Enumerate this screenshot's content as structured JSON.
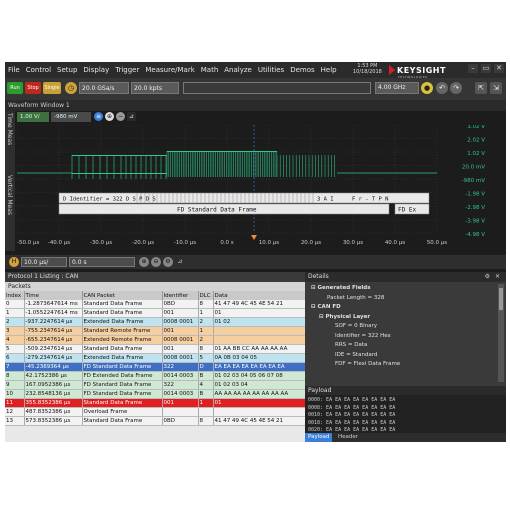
{
  "menu": [
    "File",
    "Control",
    "Setup",
    "Display",
    "Trigger",
    "Measure/Mark",
    "Math",
    "Analyze",
    "Utilities",
    "Demos",
    "Help"
  ],
  "datetime": {
    "time": "1:53 PM",
    "date": "10/18/2018"
  },
  "brand": {
    "name": "KEYSIGHT",
    "sub": "TECHNOLOGIES"
  },
  "toolbar": {
    "run": "Run",
    "stop": "Stop",
    "single": "Single",
    "sample_rate": "20.0 GSa/s",
    "memory_depth": "20.0 kpts",
    "bandwidth": "4.00 GHz"
  },
  "waveform": {
    "title": "Waveform Window 1",
    "side_tabs": [
      "Time Meas",
      "Vertical Meas"
    ],
    "channel_scale": "1.00 V/",
    "channel_offset": "-980 mV",
    "voltage_labels": [
      "3.02 V",
      "2.02 V",
      "1.02 V",
      "20.0 mV",
      "-980 mV",
      "-1.98 V",
      "-2.98 V",
      "-3.98 V",
      "-4.98 V"
    ],
    "time_labels": [
      "-50.0 µs",
      "-40.0 µs",
      "-30.0 µs",
      "-20.0 µs",
      "-10.0 µs",
      "0.0 s",
      "10.0 µs",
      "20.0 µs",
      "30.0 µs",
      "40.0 µs",
      "50.0 µs"
    ],
    "decode_line1": "D Identifier = 322  D S P D S",
    "decode_line1b": "3 A I",
    "decode_line1c": "F r - T P  N",
    "decode_line2": "FD Standard Data Frame",
    "decode_line2b": "FD Ex"
  },
  "timebase": {
    "scale": "10.0 µs/",
    "position": "0.0 s"
  },
  "listing": {
    "title": "Protocol 1 Listing : CAN",
    "section": "Packets",
    "columns": [
      "Index",
      "Time",
      "CAN Packet",
      "Identifier",
      "DLC",
      "Data"
    ],
    "rows": [
      [
        "0",
        "-1.2873647614 ms",
        "Standard Data Frame",
        "0BD",
        "8",
        "41 47 49 4C 45 4E 54 21"
      ],
      [
        "1",
        "-1.0552247614 ms",
        "Standard Data Frame",
        "001",
        "1",
        "01"
      ],
      [
        "2",
        "-937.2247614 µs",
        "Extended Data Frame",
        "0008 0001",
        "2",
        "01 02"
      ],
      [
        "3",
        "-755.2347614 µs",
        "Standard Remote Frame",
        "001",
        "1",
        ""
      ],
      [
        "4",
        "-655.2347614 µs",
        "Extended Remote Frame",
        "0008 0001",
        "2",
        ""
      ],
      [
        "5",
        "-509.2347614 µs",
        "Standard Data Frame",
        "001",
        "8",
        "01 AA BB CC AA AA AA AA"
      ],
      [
        "6",
        "-279.2347614 µs",
        "Extended Data Frame",
        "0008 0001",
        "5",
        "0A 0B 03 04 05"
      ],
      [
        "7",
        "-45.2369364 µs",
        "FD Standard Data Frame",
        "322",
        "D",
        "EA EA EA EA EA EA EA EA"
      ],
      [
        "8",
        "42.1752386 µs",
        "FD Extended Data Frame",
        "0014 0003",
        "B",
        "01 02 03 04 05 06 07 08"
      ],
      [
        "9",
        "167.0952386 µs",
        "FD Standard Data Frame",
        "322",
        "4",
        "01 02 03 04"
      ],
      [
        "10",
        "232.8548136 µs",
        "FD Standard Data Frame",
        "0014 0003",
        "B",
        "AA AA AA AA AA AA AA AA"
      ],
      [
        "11",
        "355.8352386 µs",
        "Standard Data Frame",
        "001",
        "1",
        "01"
      ],
      [
        "12",
        "487.8352386 µs",
        "Overload Frame",
        "",
        "",
        ""
      ],
      [
        "13",
        "573.8352386 µs",
        "Standard Data Frame",
        "0BD",
        "8",
        "41 47 49 4C 45 4E 54 21"
      ]
    ]
  },
  "details": {
    "title": "Details",
    "lines": [
      {
        "t": "Generated Fields",
        "lvl": 0,
        "bold": true
      },
      {
        "t": "Packet Length = 328",
        "lvl": 2,
        "bold": false
      },
      {
        "t": "CAN FD",
        "lvl": 0,
        "bold": true
      },
      {
        "t": "Physical Layer",
        "lvl": 1,
        "bold": true
      },
      {
        "t": "SOF = 0 Binary",
        "lvl": 3,
        "bold": false
      },
      {
        "t": "Identifier = 322 Hex",
        "lvl": 3,
        "bold": false
      },
      {
        "t": "RRS = Data",
        "lvl": 3,
        "bold": false
      },
      {
        "t": "IDE = Standard",
        "lvl": 3,
        "bold": false
      },
      {
        "t": "FDF = Flexi Data Frame",
        "lvl": 3,
        "bold": false
      }
    ]
  },
  "payload": {
    "title": "Payload",
    "rows": [
      "0000:  EA EA EA EA EA EA EA EA",
      "0008:  EA EA EA EA EA EA EA EA",
      "0010:  EA EA EA EA EA EA EA EA",
      "0018:  EA EA EA EA EA EA EA EA",
      "0020:  EA EA EA EA EA EA EA EA"
    ],
    "tabs": [
      "Payload",
      "Header"
    ]
  },
  "colors": {
    "trace": "#2fc98a",
    "selected_row": "#3d6fc4",
    "error_row": "#e02020",
    "remote_row": "#f5cfa0",
    "extended_row": "#bfe3ef",
    "fd_row": "#cfe8d4",
    "default_row": "#f2f2f2"
  }
}
